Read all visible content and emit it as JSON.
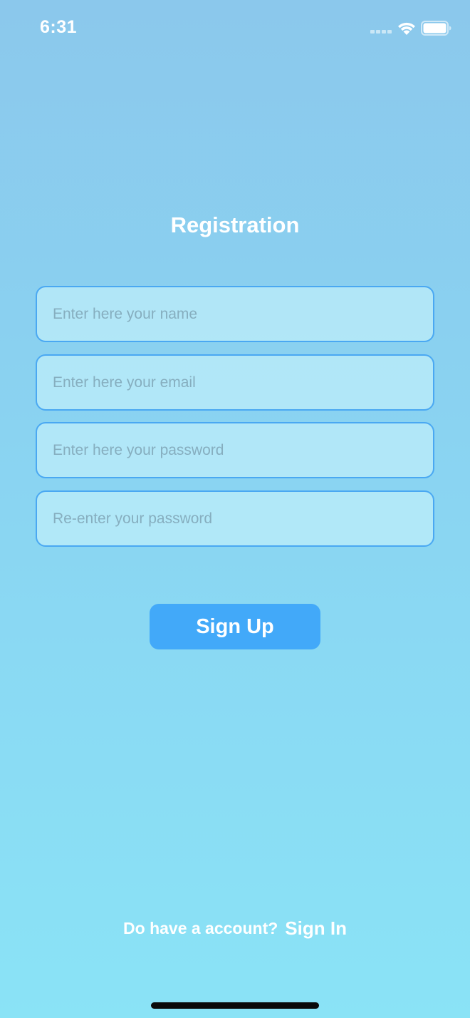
{
  "status_bar": {
    "time": "6:31",
    "icons": [
      "cellular-signal-icon",
      "wifi-icon",
      "battery-icon"
    ]
  },
  "title": "Registration",
  "form": {
    "name": {
      "placeholder": "Enter here your name",
      "value": ""
    },
    "email": {
      "placeholder": "Enter here your email",
      "value": ""
    },
    "password": {
      "placeholder": "Enter here your password",
      "value": ""
    },
    "repassword": {
      "placeholder": "Re-enter your password",
      "value": ""
    }
  },
  "signup_button": {
    "label": "Sign Up"
  },
  "footer": {
    "prompt": "Do have a account?",
    "signin_label": "Sign In"
  },
  "colors": {
    "background_top": "#8bc8ec",
    "background_bottom": "#8ae3f6",
    "input_border": "#4aa8f2",
    "button": "#42a9f9",
    "text": "#ffffff",
    "placeholder": "#86aebf"
  }
}
